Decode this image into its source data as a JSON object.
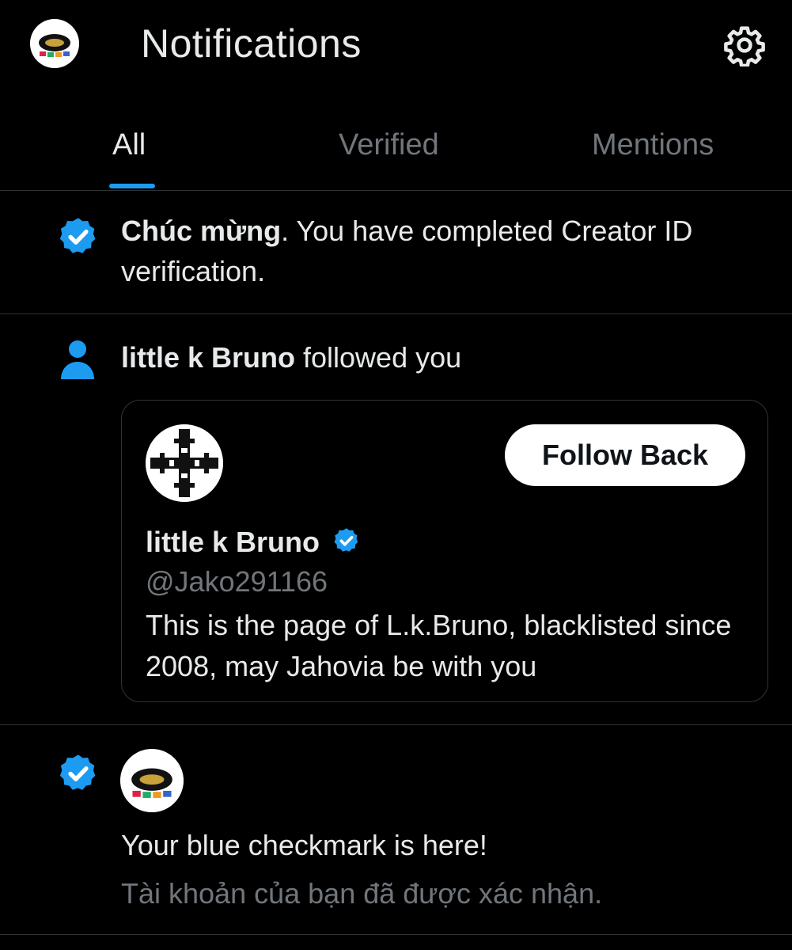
{
  "header": {
    "title": "Notifications",
    "settings_icon": "gear-icon"
  },
  "tabs": [
    {
      "label": "All",
      "active": true
    },
    {
      "label": "Verified",
      "active": false
    },
    {
      "label": "Mentions",
      "active": false
    }
  ],
  "notifications": {
    "creator": {
      "icon": "verified-badge-icon",
      "bold": "Chúc mừng",
      "text": ".  You have completed Creator ID verification."
    },
    "follow": {
      "icon": "person-icon",
      "bold": "little k Bruno",
      "text": " followed you",
      "card": {
        "name": "little k Bruno",
        "handle": "@Jako291166",
        "bio": "This is the page of L.k.Bruno, blacklisted since 2008, may Jahovia be with you",
        "button_label": "Follow Back"
      }
    },
    "checkmark": {
      "icon": "verified-badge-icon",
      "title": "Your blue checkmark is here!",
      "subtitle": "Tài khoản của bạn đã được xác nhận."
    }
  },
  "colors": {
    "background": "#000000",
    "accent": "#1d9bf0",
    "text": "#e7e9ea",
    "muted": "#71767b",
    "divider": "#2f3336"
  }
}
